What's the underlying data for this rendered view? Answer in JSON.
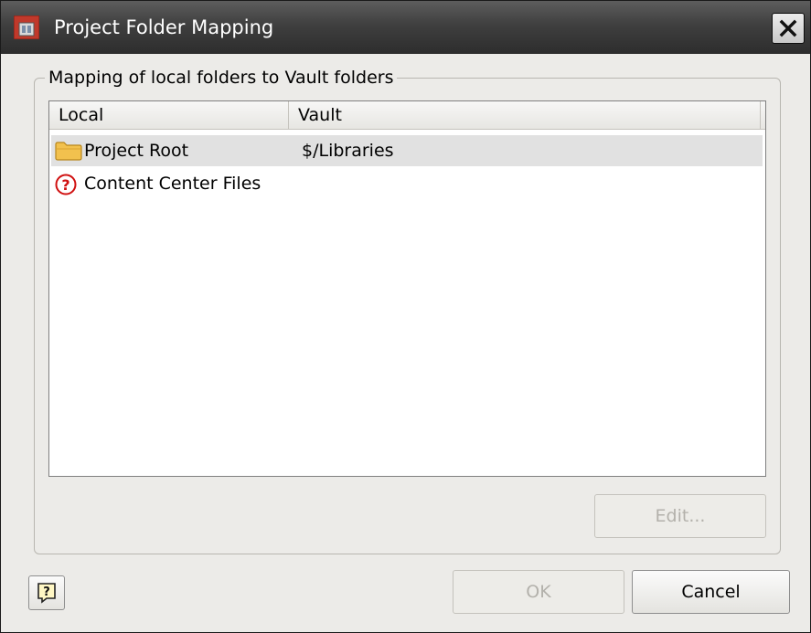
{
  "window": {
    "title": "Project Folder Mapping",
    "icon": "app-icon",
    "close_icon": "close-icon"
  },
  "group": {
    "legend": "Mapping of local folders to Vault folders"
  },
  "list": {
    "columns": [
      "Local",
      "Vault"
    ],
    "rows": [
      {
        "local": "Project Root",
        "vault": "$/Libraries",
        "icon": "folder-icon",
        "selected": true
      },
      {
        "local": "Content Center Files",
        "vault": "",
        "icon": "question-icon",
        "selected": false
      }
    ]
  },
  "buttons": {
    "edit": "Edit...",
    "ok": "OK",
    "cancel": "Cancel",
    "help_icon": "help-icon"
  },
  "colors": {
    "titlebar": "#3f3f3f",
    "dialog_bg": "#ecebe8",
    "selected_row": "#e1e1e1",
    "question_icon": "#d01010",
    "folder_icon": "#f2c14e"
  }
}
